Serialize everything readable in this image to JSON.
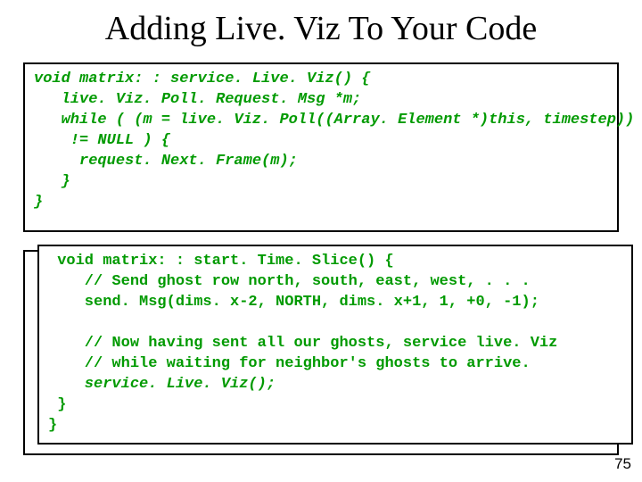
{
  "title": "Adding Live. Viz To Your Code",
  "code1": {
    "l1": "void matrix: : service. Live. Viz() {",
    "l2": "   live. Viz. Poll. Request. Msg *m;",
    "l3": "   while ( (m = live. Viz. Poll((Array. Element *)this, timestep))",
    "l4": "    != NULL ) {",
    "l5": "     request. Next. Frame(m);",
    "l6": "   }",
    "l7": "}"
  },
  "code2": {
    "l1": " void matrix: : start. Time. Slice() {",
    "l2": "    // Send ghost row north, south, east, west, . . .",
    "l3": "    send. Msg(dims. x-2, NORTH, dims. x+1, 1, +0, -1);",
    "l4": "",
    "l5": "    // Now having sent all our ghosts, service live. Viz",
    "l6": "    // while waiting for neighbor's ghosts to arrive.",
    "l7": "    service. Live. Viz();",
    "l8": " }",
    "l9": "}"
  },
  "pagenum": "75"
}
